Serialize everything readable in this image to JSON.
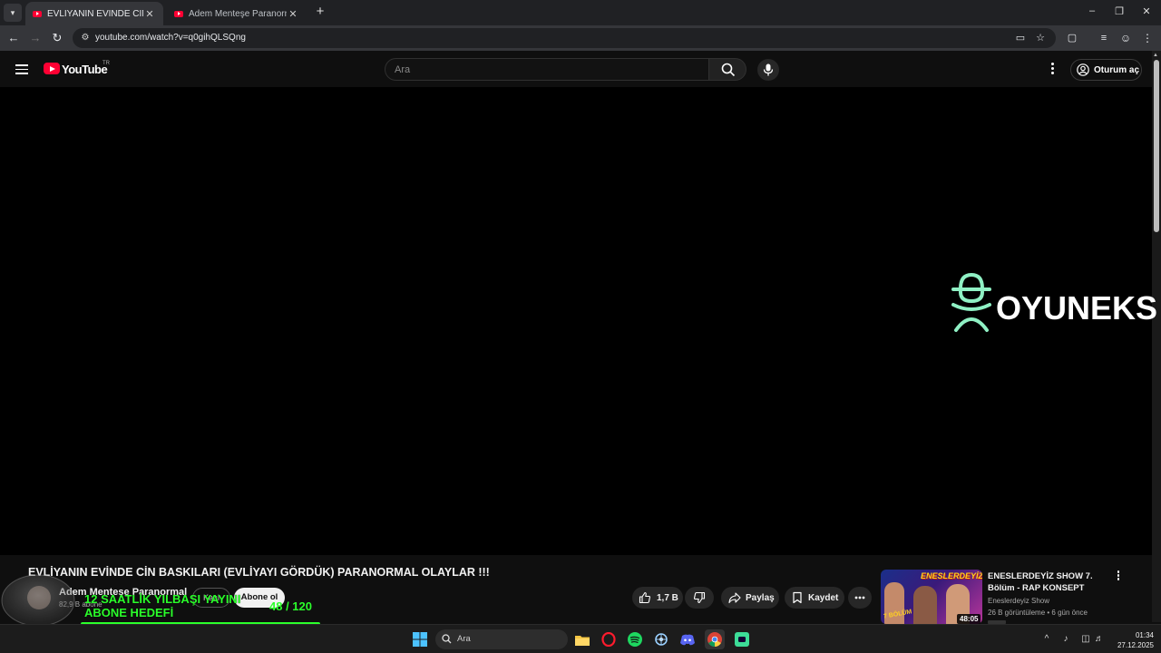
{
  "browser": {
    "tabs": [
      {
        "title": "EVLİYANIN EVİNDE CİN BASKIL",
        "active": true
      },
      {
        "title": "Adem Menteşe Paranormal - Yo",
        "active": false
      }
    ],
    "url": "youtube.com/watch?v=q0gihQLSQng"
  },
  "youtube": {
    "logo_text": "YouTube",
    "country_code": "TR",
    "search_placeholder": "Ara",
    "signin_label": "Oturum aç"
  },
  "player": {
    "overlay_brand": "OYUNEKS"
  },
  "video": {
    "title": "EVLİYANIN EVİNDE CİN BASKILARI (EVLİYAYI GÖRDÜK) PARANORMAL OLAYLAR !!!",
    "channel_name": "Adem Menteşe Paranormal",
    "subscribers": "82,9 B abone",
    "join_label": "Katıl",
    "subscribe_label": "Abone ol",
    "like_count": "1,7 B",
    "share_label": "Paylaş",
    "save_label": "Kaydet"
  },
  "stream_overlay": {
    "title_line1": "12 SAATLİK YILBAŞI YAYINI",
    "title_line2": "ABONE HEDEFİ",
    "current": "48",
    "goal": "120",
    "count_text": "48  / 120",
    "progress_fraction": 0.4
  },
  "recommendation": {
    "title": "ENESLERDEYİZ SHOW 7. Bölüm - RAP KONSEPT",
    "channel": "Eneslerdeyiz Show",
    "meta": "26 B görüntüleme • 6 gün önce",
    "duration": "48:05",
    "thumbnail_logo": "ENESLERDEYİZ",
    "thumbnail_episode": "7 BÖLÜM"
  },
  "taskbar": {
    "search_placeholder": "Ara",
    "time": "01:34",
    "date": "27.12.2025"
  },
  "colors": {
    "yt_red": "#ff0033",
    "overlay_green": "#2bff2b",
    "brand_mint": "#8ff0c4"
  }
}
